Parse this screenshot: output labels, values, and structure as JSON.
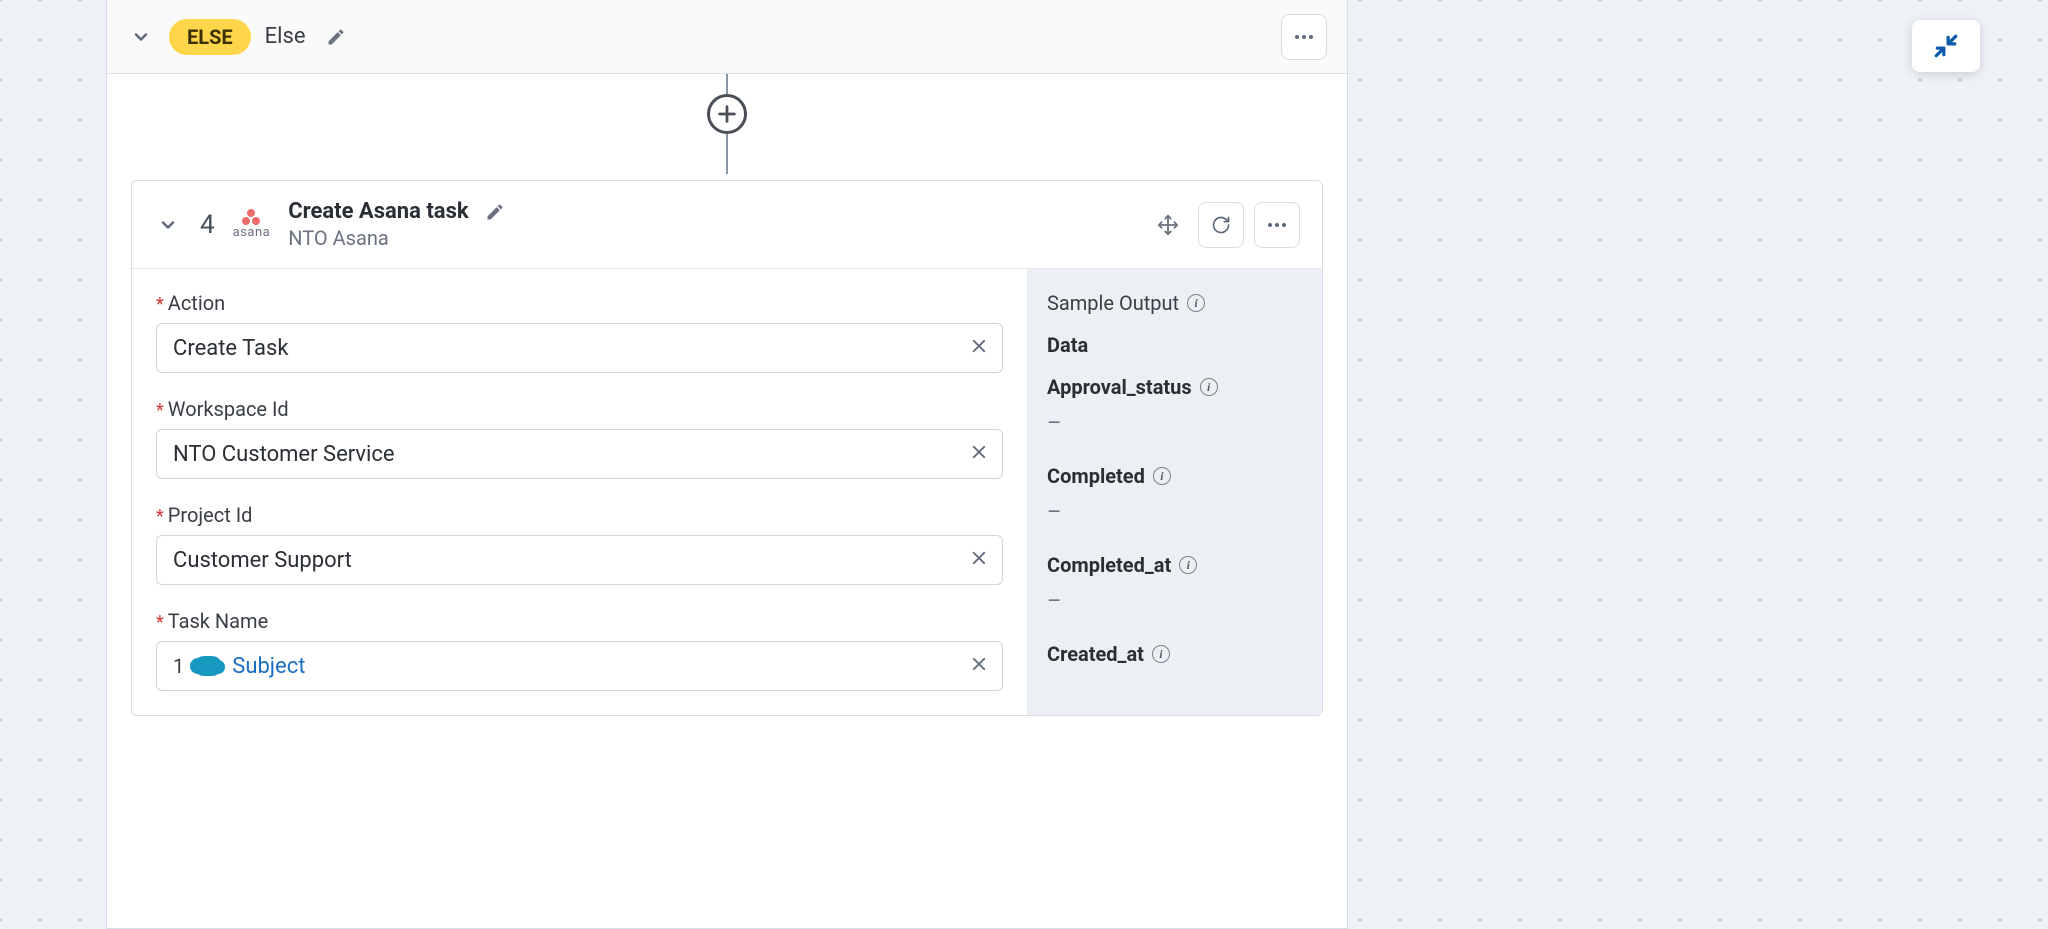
{
  "else_branch": {
    "pill": "ELSE",
    "label": "Else"
  },
  "step": {
    "number": "4",
    "connector_label": "asana",
    "title": "Create Asana task",
    "subtitle": "NTO Asana",
    "fields": {
      "action": {
        "label": "Action",
        "value": "Create Task"
      },
      "workspace": {
        "label": "Workspace Id",
        "value": "NTO Customer Service"
      },
      "project": {
        "label": "Project Id",
        "value": "Customer Support"
      },
      "task_name": {
        "label": "Task Name",
        "token_index": "1",
        "token_text": "Subject"
      }
    }
  },
  "output": {
    "header": "Sample Output",
    "group": "Data",
    "fields": [
      {
        "name": "Approval_status",
        "value": "–"
      },
      {
        "name": "Completed",
        "value": "–"
      },
      {
        "name": "Completed_at",
        "value": "–"
      },
      {
        "name": "Created_at",
        "value": ""
      }
    ]
  }
}
